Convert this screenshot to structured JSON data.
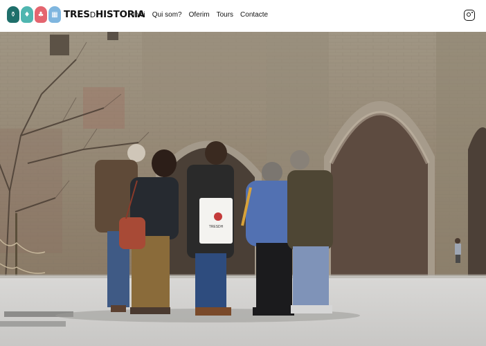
{
  "brand": {
    "name_left": "TRES",
    "name_mid": "D",
    "name_right": "HISTORIA",
    "icon_colors": [
      "#1f6f6b",
      "#4fb6b0",
      "#e4656f",
      "#7fb6df"
    ]
  },
  "nav": {
    "items": [
      {
        "label": "Inici"
      },
      {
        "label": "Qui som?"
      },
      {
        "label": "Oferim"
      },
      {
        "label": "Tours"
      },
      {
        "label": "Contacte"
      }
    ]
  },
  "social": {
    "icon": "instagram-icon"
  },
  "hero": {
    "tote_bag_text": "TRESDH"
  }
}
